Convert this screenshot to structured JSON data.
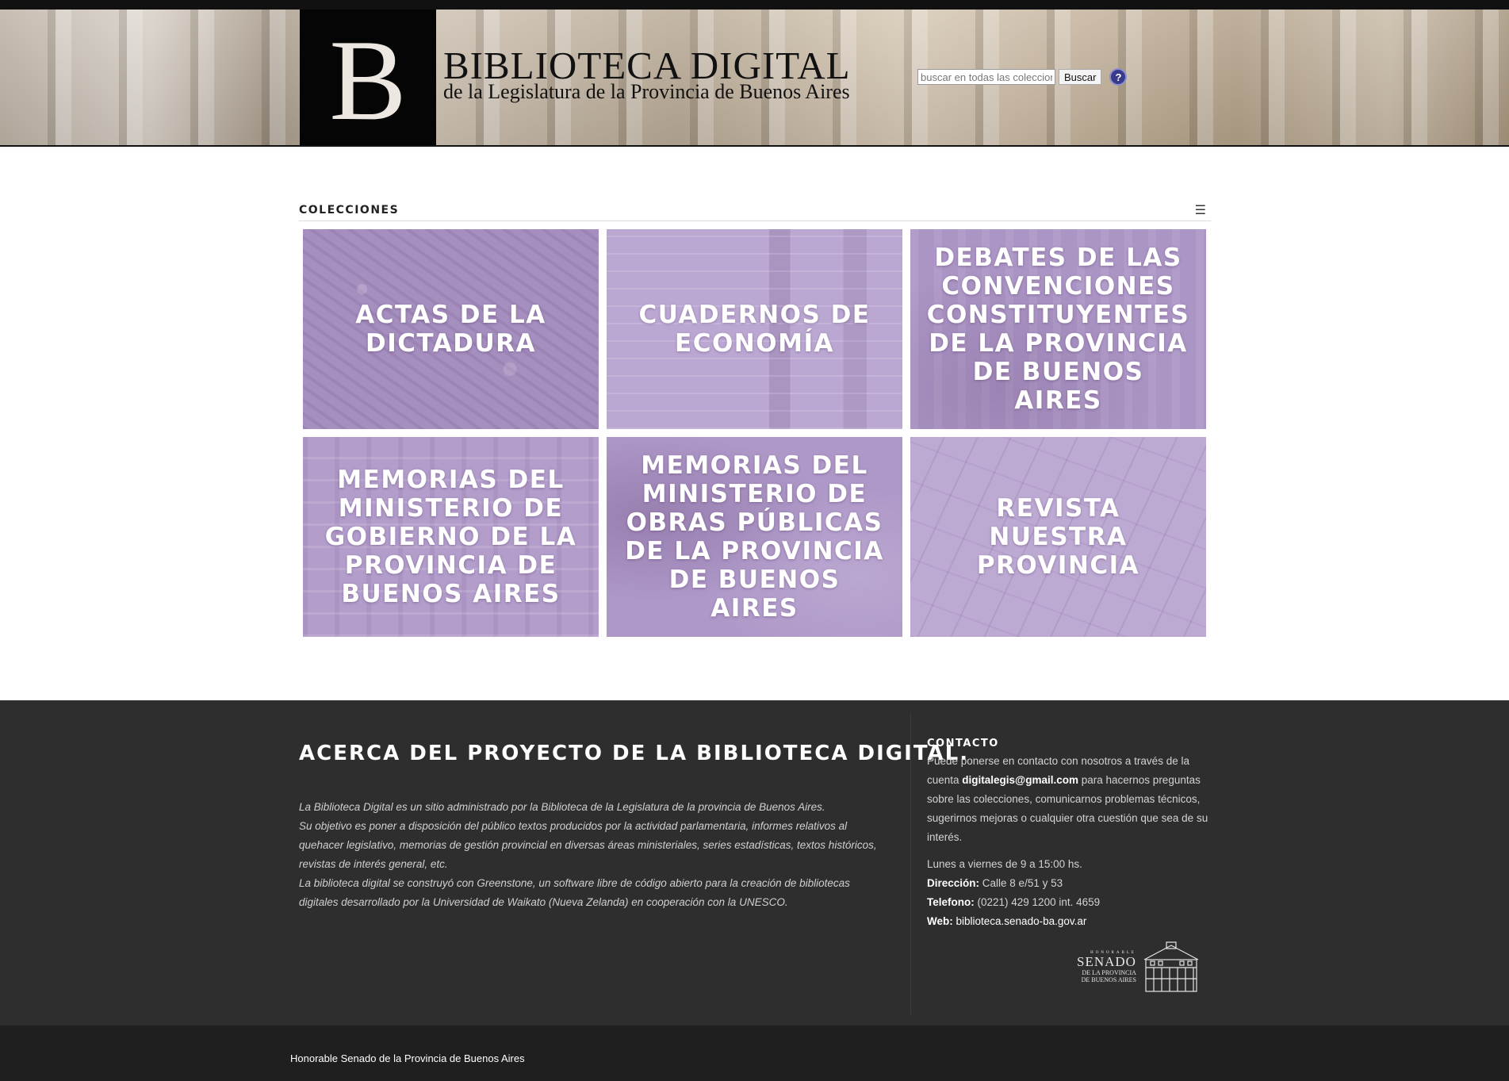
{
  "header": {
    "logo_letter": "B",
    "title": "BIBLIOTECA DIGITAL",
    "subtitle": "de la Legislatura de la Provincia de Buenos Aires",
    "search": {
      "placeholder": "buscar en todas las colecciones",
      "button_label": "Buscar",
      "help_label": "?"
    }
  },
  "collections": {
    "heading": "COLECCIONES",
    "menu_icon": "☰",
    "items": [
      {
        "label": "Actas de la Dictadura"
      },
      {
        "label": "Cuadernos de Economía"
      },
      {
        "label": "Debates de las Convenciones Constituyentes de la Provincia de Buenos Aires"
      },
      {
        "label": "Memorias del Ministerio de Gobierno de la Provincia de Buenos Aires"
      },
      {
        "label": "Memorias del Ministerio de Obras Públicas de la Provincia de Buenos Aires"
      },
      {
        "label": "Revista Nuestra Provincia"
      }
    ]
  },
  "footer": {
    "about_title": "ACERCA DEL PROYECTO DE LA BIBLIOTECA DIGITAL.",
    "about_lines": [
      "La Biblioteca Digital es un sitio administrado por la Biblioteca de la Legislatura de la provincia de Buenos Aires.",
      "Su objetivo es poner a disposición del público textos producidos por la actividad parlamentaria, informes relativos al quehacer legislativo, memorias de gestión provincial en diversas áreas ministeriales, series estadísticas, textos históricos, revistas de interés general, etc.",
      "La biblioteca digital se construyó con Greenstone, un software libre de código abierto para la creación de bibliotecas digitales desarrollado por la Universidad de Waikato (Nueva Zelanda) en cooperación con la UNESCO."
    ],
    "contact": {
      "title": "CONTACTO",
      "intro_before": "Puede ponerse en contacto con nosotros a través de la cuenta ",
      "email": "digitalegis@gmail.com",
      "intro_after": " para hacernos preguntas sobre las colecciones, comunicarnos problemas técnicos, sugerirnos mejoras o cualquier otra cuestión que sea de su interés.",
      "hours": "Lunes a viernes de 9 a 15:00 hs.",
      "address_label": "Dirección:",
      "address_value": " Calle 8 e/51 y 53",
      "phone_label": "Telefono:",
      "phone_value": " (0221) 429 1200 int. 4659",
      "web_label": "Web:",
      "web_value": " biblioteca.senado-ba.gov.ar"
    },
    "senado_logo": {
      "small": "HONORABLE",
      "big": "SENADO",
      "sub1": "DE LA PROVINCIA",
      "sub2": "DE BUENOS AIRES"
    },
    "bottom_text": "Honorable Senado de la Provincia de Buenos Aires"
  }
}
